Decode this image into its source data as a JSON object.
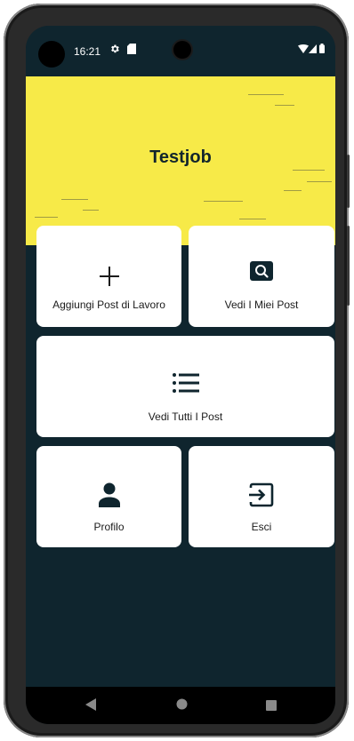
{
  "status_bar": {
    "time": "16:21"
  },
  "header": {
    "title": "Testjob",
    "background_color": "#f7ea48"
  },
  "menu": {
    "add_job_post": {
      "label": "Aggiungi Post di Lavoro",
      "icon": "plus-icon"
    },
    "my_posts": {
      "label": "Vedi I Miei Post",
      "icon": "search-icon"
    },
    "all_posts": {
      "label": "Vedi Tutti I Post",
      "icon": "list-icon"
    },
    "profile": {
      "label": "Profilo",
      "icon": "person-icon"
    },
    "logout": {
      "label": "Esci",
      "icon": "logout-icon"
    }
  },
  "nav_bar": {
    "back_icon": "back-icon",
    "home_icon": "home-icon",
    "recents_icon": "recents-icon"
  },
  "colors": {
    "app_background": "#0f252e",
    "card_background": "#ffffff",
    "accent": "#f7ea48"
  }
}
